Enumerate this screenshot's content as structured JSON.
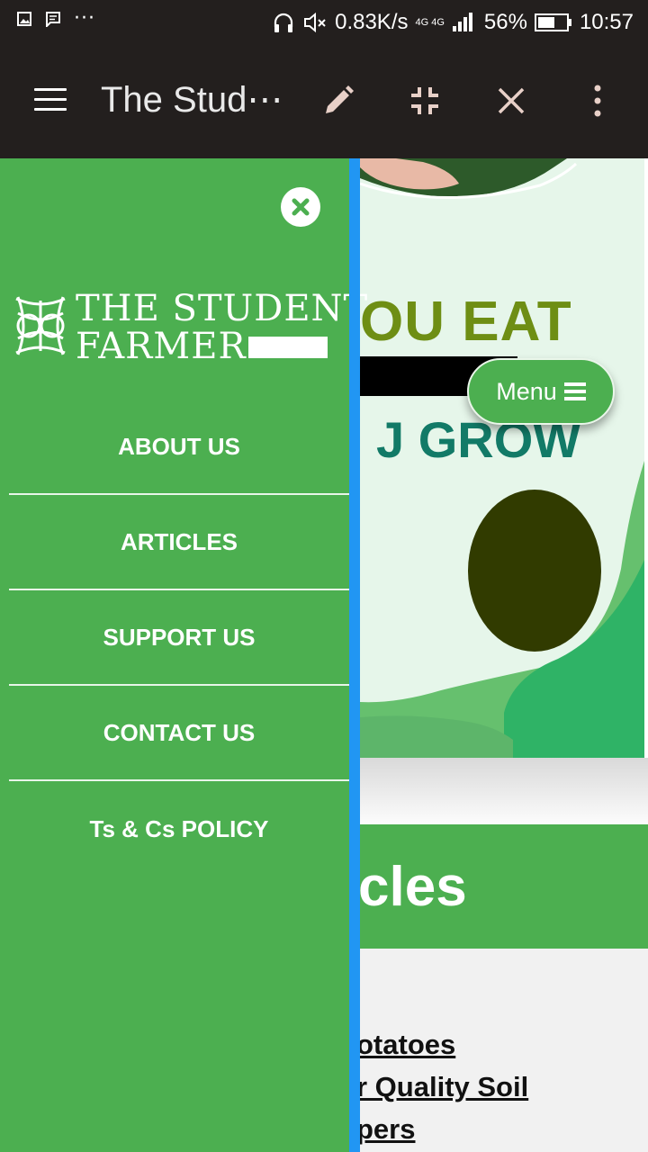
{
  "status_bar": {
    "speed": "0.83K/s",
    "network": "4G 4G",
    "battery": "56%",
    "time": "10:57"
  },
  "browser": {
    "title": "The Stud⋯"
  },
  "drawer": {
    "logo_line1": "THE STUDENT",
    "logo_line2": "FARMER",
    "nav_items": [
      "ABOUT US",
      "ARTICLES",
      "SUPPORT US",
      "CONTACT US",
      "Ts & Cs POLICY"
    ]
  },
  "page": {
    "hero_line1": "OU EAT",
    "hero_line2": "J GROW",
    "menu_button": "Menu",
    "articles_heading": "cles",
    "article_links": [
      "otatoes",
      "r Quality Soil",
      "pers"
    ]
  },
  "colors": {
    "drawer_green": "#4caf50",
    "drawer_edge_blue": "#2196f3",
    "toolbar_dark": "#231f1e"
  }
}
